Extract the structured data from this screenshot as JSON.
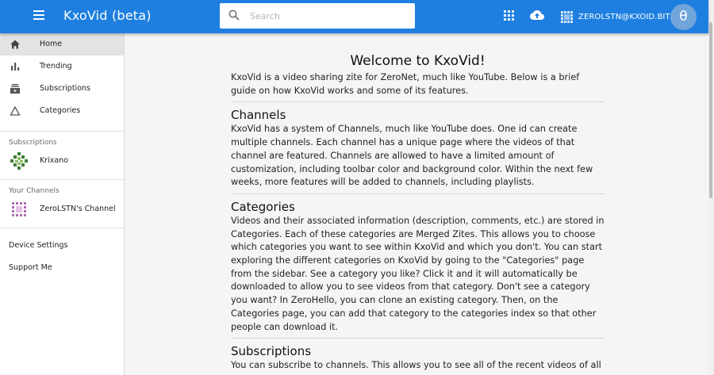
{
  "header": {
    "app_title": "KxoVid (beta)",
    "search_placeholder": "Search",
    "user_name": "ZEROLSTN@KXOID.BIT",
    "avatar_letter": "θ",
    "bar_color": "#1e7fe0"
  },
  "sidebar": {
    "nav": [
      {
        "label": "Home",
        "icon": "home-icon",
        "active": true
      },
      {
        "label": "Trending",
        "icon": "bar-chart-icon"
      },
      {
        "label": "Subscriptions",
        "icon": "subscriptions-icon"
      },
      {
        "label": "Categories",
        "icon": "triangle-icon"
      }
    ],
    "subscriptions_heading": "Subscriptions",
    "subscriptions": [
      {
        "label": "Krixano"
      }
    ],
    "channels_heading": "Your Channels",
    "channels": [
      {
        "label": "ZeroLSTN's Channel"
      }
    ],
    "bottom": [
      {
        "label": "Device Settings"
      },
      {
        "label": "Support Me"
      }
    ]
  },
  "main": {
    "title": "Welcome to KxoVid!",
    "intro": "KxoVid is a video sharing zite for ZeroNet, much like YouTube. Below is a brief guide on how KxoVid works and some of its features.",
    "sections": [
      {
        "heading": "Channels",
        "body": "KxoVid has a system of Channels, much like YouTube does. One id can create multiple channels. Each channel has a unique page where the videos of that channel are featured. Channels are allowed to have a limited amount of customization, including toolbar color and background color. Within the next few weeks, more features will be added to channels, including playlists."
      },
      {
        "heading": "Categories",
        "body": "Videos and their associated information (description, comments, etc.) are stored in Categories. Each of these categories are Merged Zites. This allows you to choose which categories you want to see within KxoVid and which you don't. You can start exploring the different categories on KxoVid by going to the \"Categories\" page from the sidebar. See a category you like? Click it and it will automatically be downloaded to allow you to see videos from that category. Don't see a category you want? In ZeroHello, you can clone an existing category. Then, on the Categories page, you can add that category to the categories index so that other people can download it."
      },
      {
        "heading": "Subscriptions",
        "body": "You can subscribe to channels. This allows you to see all of the recent videos of all"
      }
    ]
  }
}
